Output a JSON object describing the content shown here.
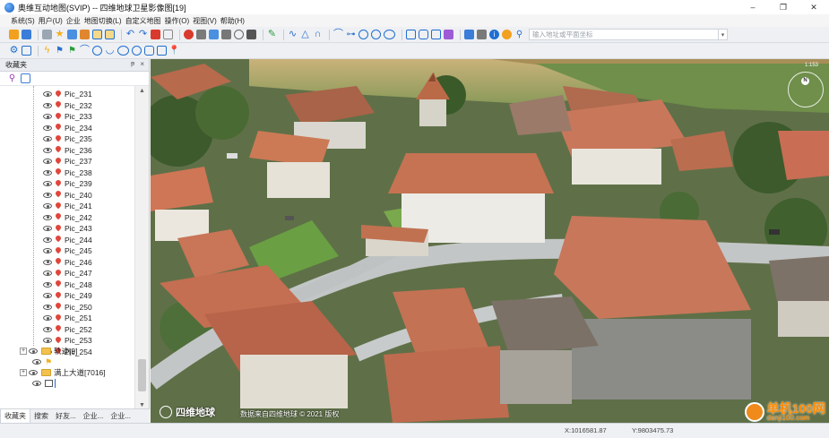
{
  "window": {
    "title": "奥维互动地图(SVIP) -- 四维地球卫星影像图[19]",
    "controls": {
      "minimize": "–",
      "restore": "❐",
      "close": "✕"
    }
  },
  "menu": [
    "系统(S)",
    "用户(U)",
    "企业",
    "地图切换(L)",
    "自定义地图",
    "操作(O)",
    "视图(V)",
    "帮助(H)"
  ],
  "toolbar": {
    "search_placeholder": "输入地址或平面坐标"
  },
  "panel": {
    "title": "收藏夹",
    "pin": "ᵽ",
    "close": "×",
    "pics": [
      "Pic_231",
      "Pic_232",
      "Pic_233",
      "Pic_234",
      "Pic_235",
      "Pic_236",
      "Pic_237",
      "Pic_238",
      "Pic_239",
      "Pic_240",
      "Pic_241",
      "Pic_242",
      "Pic_243",
      "Pic_244",
      "Pic_245",
      "Pic_246",
      "Pic_247",
      "Pic_248",
      "Pic_249",
      "Pic_250",
      "Pic_251",
      "Pic_252",
      "Pic_253",
      "Pic_254"
    ],
    "folder_track": "轨迹[9]",
    "folder_road": "满上大道[7016]",
    "expand_symbol": "+"
  },
  "tabs": [
    "收藏夹",
    "搜索",
    "好友...",
    "企业...",
    "企业..."
  ],
  "map": {
    "logo": "四维地球",
    "credit": "数据来自四维地球 © 2021 版权",
    "compass_n": "N",
    "zoom_label": "1:153",
    "watermark_main": "单机100网",
    "watermark_sub": "danji100.com"
  },
  "status": {
    "x": "X:1016581.87",
    "y": "Y:9803475.73"
  }
}
